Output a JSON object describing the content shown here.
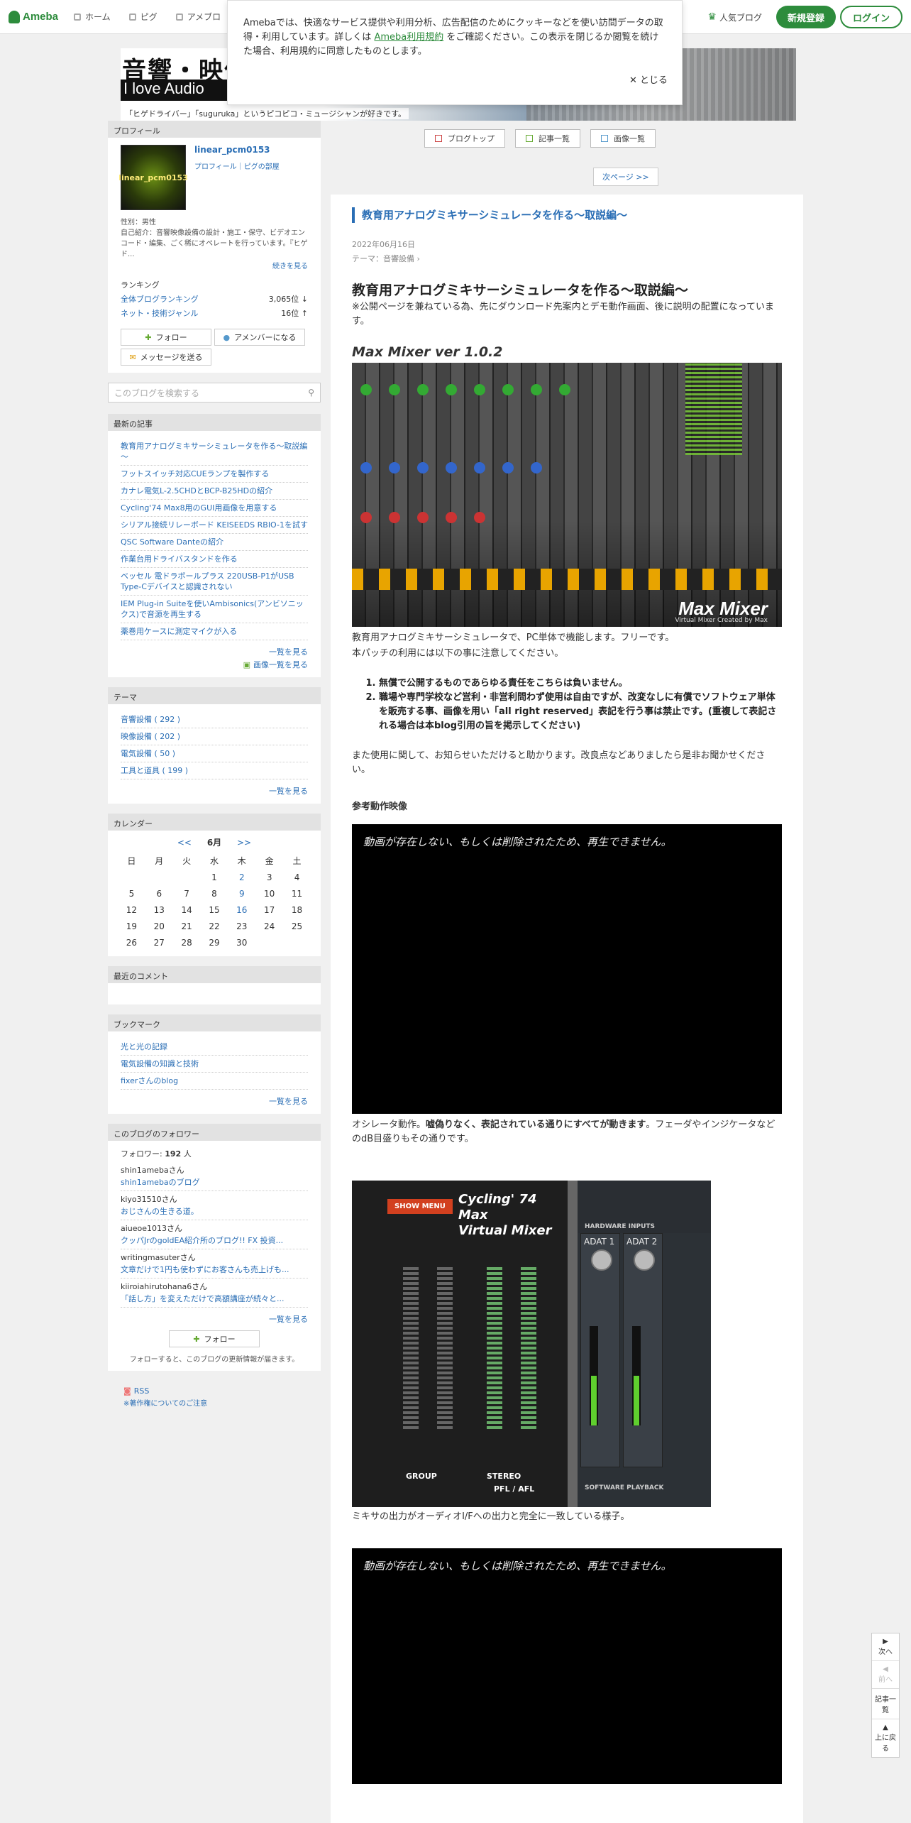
{
  "topbar": {
    "logo": "Ameba",
    "nav": [
      "ホーム",
      "ピグ",
      "アメブロ"
    ],
    "popular": "人気ブログ",
    "register": "新規登録",
    "login": "ログイン"
  },
  "cookie": {
    "text_before": "Amebaでは、快適なサービス提供や利用分析、広告配信のためにクッキーなどを使い訪問データの取得・利用しています。詳しくは ",
    "link": "Ameba利用規約",
    "text_after": " をご確認ください。この表示を閉じるか閲覧を続けた場合、利用規約に同意したものとします。",
    "close": "✕ とじる"
  },
  "header": {
    "title_jp": "音響・映像",
    "title_en": "I love Audio",
    "description": "「ヒゲドライバー」「suguruka」というピコピコ・ミュージシャンが好きです。"
  },
  "profile": {
    "heading": "プロフィール",
    "avatar_text": "linear_pcm0153",
    "name": "linear_pcm0153",
    "links": "プロフィール｜ピグの部屋",
    "gender": "性別：男性",
    "intro": "自己紹介：音響映像設備の設計・施工・保守、ビデオエンコード・編集、ごく稀にオペレートを行っています。『ヒゲド...",
    "more": "続きを見る",
    "ranking_title": "ランキング",
    "rank_all_label": "全体ブログランキング",
    "rank_all_value": "3,065位 ↓",
    "rank_genre_label": "ネット・技術ジャンル",
    "rank_genre_value": "16位 ↑",
    "follow": "フォロー",
    "amember": "アメンバーになる",
    "message": "メッセージを送る"
  },
  "search": {
    "placeholder": "このブログを検索する"
  },
  "recent": {
    "heading": "最新の記事",
    "items": [
      "教育用アナログミキサーシミュレータを作る～取説編～",
      "フットスイッチ対応CUEランプを製作する",
      "カナレ電気L-2.5CHDとBCP-B25HDの紹介",
      "Cycling'74 Max8用のGUI用画像を用意する",
      "シリアル接続リレーボード KEISEEDS RBIO-1を試す",
      "QSC Software Danteの紹介",
      "作業台用ドライバスタンドを作る",
      "ベッセル 電ドラボールプラス 220USB-P1がUSB Type-Cデバイスと認識されない",
      "IEM Plug-in Suiteを使いAmbisonics(アンビソニックス)で音源を再生する",
      "薬巻用ケースに測定マイクが入る"
    ],
    "list_link": "一覧を見る",
    "image_link": "画像一覧を見る"
  },
  "theme": {
    "heading": "テーマ",
    "items": [
      "音響設備 ( 292 )",
      "映像設備 ( 202 )",
      "電気設備 ( 50 )",
      "工具と道具 ( 199 )"
    ],
    "list_link": "一覧を見る"
  },
  "calendar": {
    "heading": "カレンダー",
    "prev": "<<",
    "month": "6月",
    "next": ">>",
    "weekdays": [
      "日",
      "月",
      "火",
      "水",
      "木",
      "金",
      "土"
    ],
    "weeks": [
      [
        "",
        "",
        "",
        "1",
        "2",
        "3",
        "4"
      ],
      [
        "5",
        "6",
        "7",
        "8",
        "9",
        "10",
        "11"
      ],
      [
        "12",
        "13",
        "14",
        "15",
        "16",
        "17",
        "18"
      ],
      [
        "19",
        "20",
        "21",
        "22",
        "23",
        "24",
        "25"
      ],
      [
        "26",
        "27",
        "28",
        "29",
        "30",
        "",
        ""
      ]
    ],
    "highlight": [
      "2",
      "9",
      "16"
    ]
  },
  "comments": {
    "heading": "最近のコメント"
  },
  "bookmarks": {
    "heading": "ブックマーク",
    "items": [
      "光と光の記録",
      "電気設備の知識と技術",
      "fixerさんのblog"
    ],
    "list_link": "一覧を見る"
  },
  "followers": {
    "heading": "このブログのフォロワー",
    "count_label": "フォロワー:",
    "count": "192",
    "count_unit": "人",
    "items": [
      {
        "user": "shin1amebaさん",
        "blog": "shin1amebaのブログ"
      },
      {
        "user": "kiyo31510さん",
        "blog": "おじさんの生きる道。"
      },
      {
        "user": "aiueoe1013さん",
        "blog": "クッパJrのgoldEA紹介所のブログ!! FX 投資..."
      },
      {
        "user": "writingmasuterさん",
        "blog": "文章だけで1円も使わずにお客さんも売上げも..."
      },
      {
        "user": "kiiroiahirutohana6さん",
        "blog": "「話し方」を変えただけで高額講座が続々と..."
      }
    ],
    "list_link": "一覧を見る",
    "follow": "フォロー",
    "note": "フォローすると、このブログの更新情報が届きます。"
  },
  "footer_side": {
    "rss": "RSS",
    "copyright": "※著作権についてのご注意"
  },
  "blognav": {
    "top": "ブログトップ",
    "articles": "記事一覧",
    "images": "画像一覧",
    "next_page": "次ページ >>"
  },
  "article": {
    "title_small": "教育用アナログミキサーシミュレータを作る～取説編～",
    "date": "2022年06月16日",
    "theme": "テーマ：音響設備 ›",
    "heading": "教育用アナログミキサーシミュレータを作る～取説編～",
    "note": "※公開ページを兼ねている為、先にダウンロード先案内とデモ動作画面、後に説明の配置になっています。",
    "mm_title": "Max Mixer ver 1.0.2",
    "mm_logo": "Max Mixer",
    "mm_sub": "Virtual Mixer Created by Max",
    "desc1": "教育用アナログミキサーシミュレータで、PC単体で機能します。フリーです。",
    "desc2": "本パッチの利用には以下の事に注意してください。",
    "rules": [
      "無償で公開するものであらゆる責任をこちらは負いません。",
      "職場や専門学校など営利・非営利問わず使用は自由ですが、改変なしに有償でソフトウェア単体を販売する事、画像を用い「all right reserved」表記を行う事は禁止です。(重複して表記される場合は本blog引用の旨を掲示してください)"
    ],
    "feedback": "また使用に関して、お知らせいただけると助かります。改良点などありましたら是非お聞かせください。",
    "ref_video": "参考動作映像",
    "video_msg": "動画が存在しない、もしくは削除されたため、再生できません。",
    "osc_before": "オシレータ動作。",
    "osc_bold": "嘘偽りなく、表記されている通りにすべてが動きます",
    "osc_after": "。フェーダやインジケータなどのdB目盛りもその通りです。",
    "c74_title_1": "Cycling' 74 Max",
    "c74_title_2": "Virtual Mixer",
    "show_menu": "SHOW MENU",
    "group": "GROUP",
    "stereo": "STEREO",
    "pfl": "PFL / AFL",
    "adat1": "ADAT 1",
    "adat2": "ADAT 2",
    "hw_inputs": "HARDWARE INPUTS",
    "sw_playback": "SOFTWARE PLAYBACK",
    "output_caption": "ミキサの出力がオーディオI/Fへの出力と完全に一致している様子。",
    "video_msg2": "動画が存在しない、もしくは削除されたため、再生できません。"
  },
  "floatnav": {
    "next": "次へ",
    "prev": "前へ",
    "list": "記事一覧",
    "top": "上に戻る"
  }
}
